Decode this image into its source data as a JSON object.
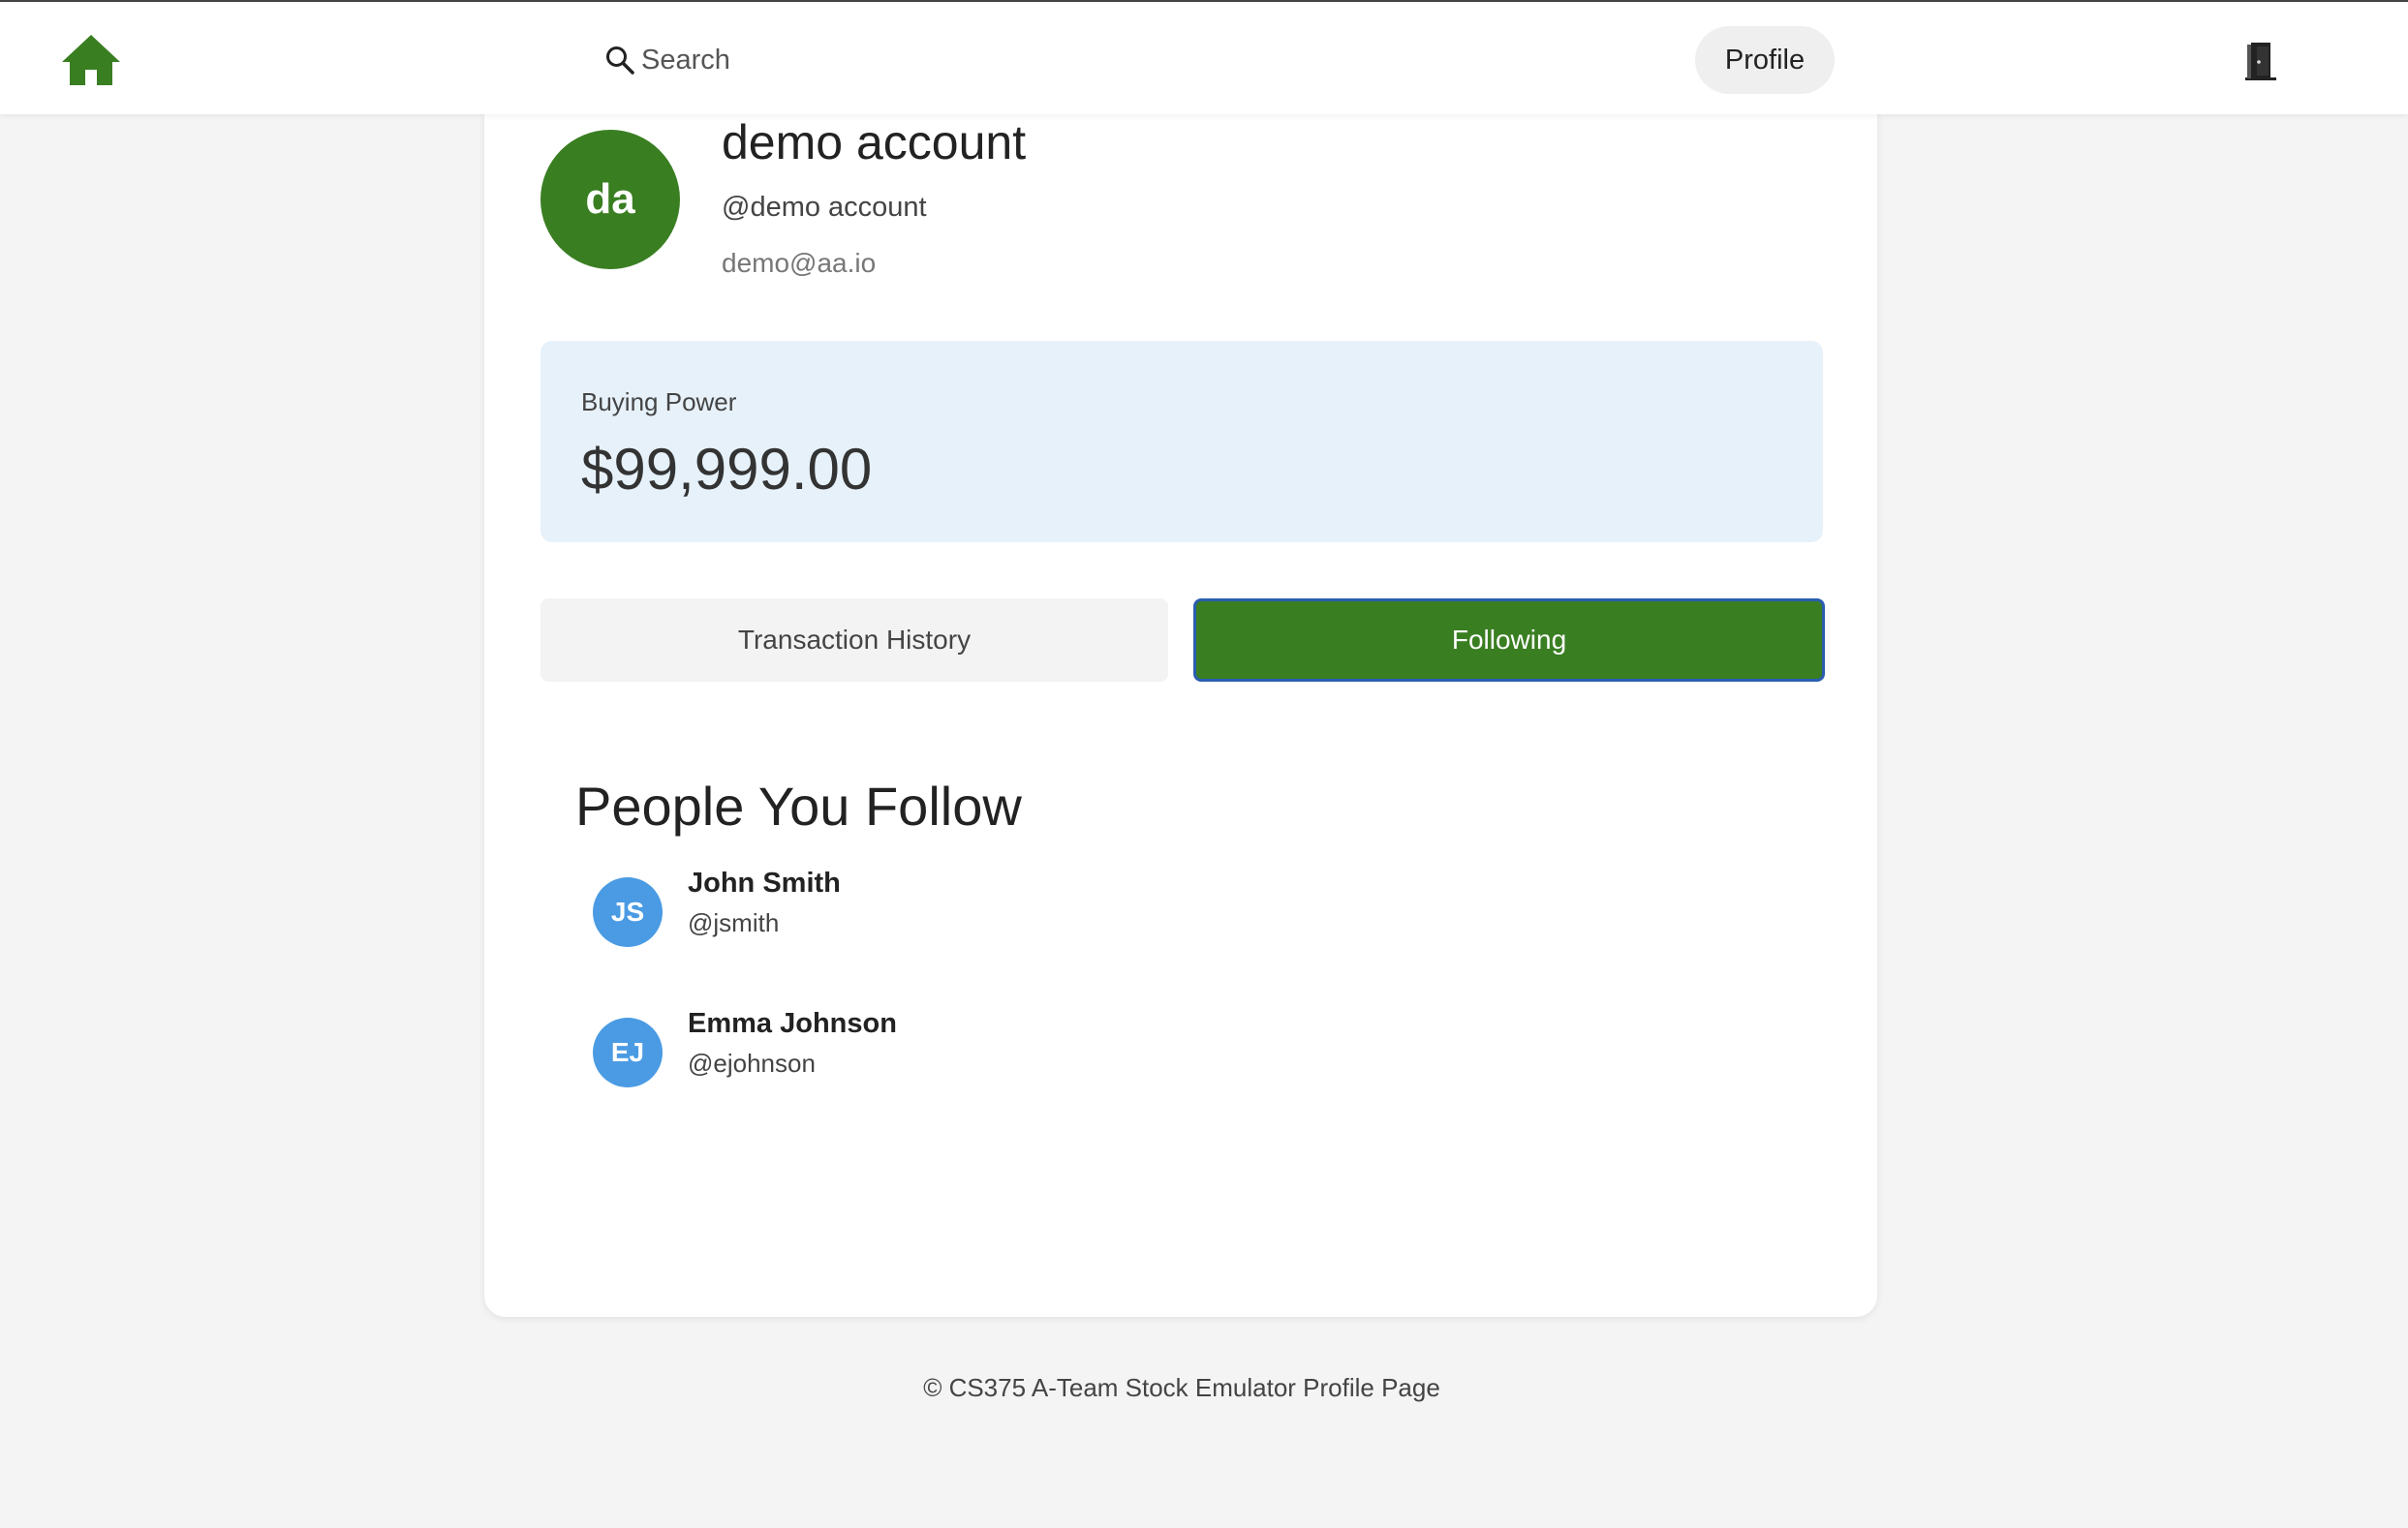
{
  "nav": {
    "search_label": "Search",
    "profile_label": "Profile"
  },
  "profile": {
    "initials": "da",
    "display_name": "demo account",
    "handle": "@demo account",
    "email": "demo@aa.io"
  },
  "buying_power": {
    "label": "Buying Power",
    "value": "$99,999.00"
  },
  "tabs": [
    {
      "label": "Transaction History",
      "active": false
    },
    {
      "label": "Following",
      "active": true
    }
  ],
  "following": {
    "title": "People You Follow",
    "people": [
      {
        "initials": "JS",
        "name": "John Smith",
        "handle": "@jsmith"
      },
      {
        "initials": "EJ",
        "name": "Emma Johnson",
        "handle": "@ejohnson"
      }
    ]
  },
  "footer": {
    "text": "© CS375 A-Team Stock Emulator Profile Page"
  },
  "colors": {
    "brand_green": "#3a7e22",
    "avatar_blue": "#4a9be3",
    "buying_power_bg": "#e6f1fa",
    "active_tab_border": "#2a5db0"
  },
  "icons": {
    "home": "home-icon",
    "search": "search-icon",
    "logout": "door-icon"
  }
}
